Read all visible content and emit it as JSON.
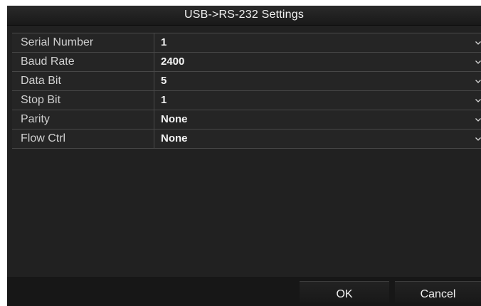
{
  "dialog": {
    "title": "USB->RS-232 Settings"
  },
  "settings": [
    {
      "label": "Serial Number",
      "value": "1"
    },
    {
      "label": "Baud Rate",
      "value": "2400"
    },
    {
      "label": "Data Bit",
      "value": "5"
    },
    {
      "label": "Stop Bit",
      "value": "1"
    },
    {
      "label": "Parity",
      "value": "None"
    },
    {
      "label": "Flow Ctrl",
      "value": "None"
    }
  ],
  "buttons": {
    "ok_label": "OK",
    "cancel_label": "Cancel"
  },
  "icons": {
    "dropdown": "chevron-down-icon"
  },
  "colors": {
    "dialog_bg": "#212121",
    "text": "#f2f2f2",
    "grid_line": "#4a4a4a"
  }
}
